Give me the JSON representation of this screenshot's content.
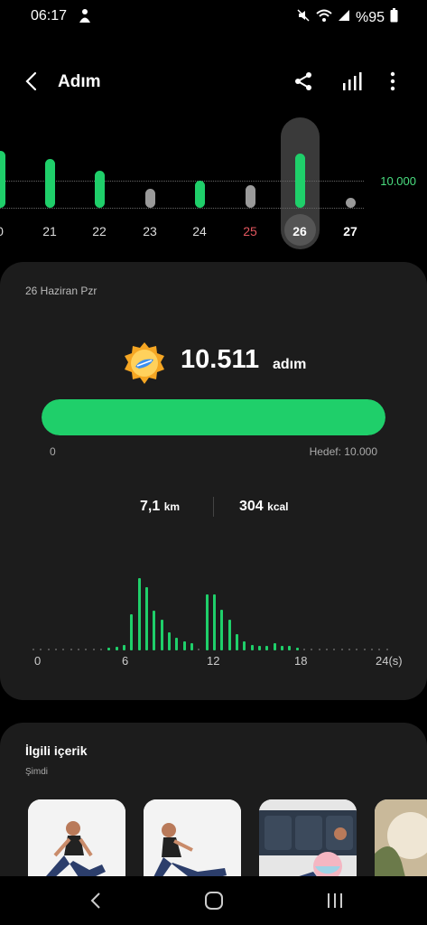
{
  "status": {
    "time": "06:17",
    "battery": "%95"
  },
  "header": {
    "title": "Adım"
  },
  "week": {
    "goal_label": "10.000",
    "days": [
      {
        "label": "0",
        "value": 11000,
        "color": "#1fcf6a",
        "label_color": "#dddddd"
      },
      {
        "label": "21",
        "value": 9500,
        "color": "#1fcf6a",
        "label_color": "#dddddd"
      },
      {
        "label": "22",
        "value": 7200,
        "color": "#1fcf6a",
        "label_color": "#dddddd"
      },
      {
        "label": "23",
        "value": 3600,
        "color": "#9a9a9a",
        "label_color": "#dddddd"
      },
      {
        "label": "24",
        "value": 5200,
        "color": "#1fcf6a",
        "label_color": "#dddddd"
      },
      {
        "label": "25",
        "value": 4400,
        "color": "#9a9a9a",
        "label_color": "#e2565e"
      },
      {
        "label": "26",
        "value": 10511,
        "color": "#1fcf6a",
        "label_color": "#ffffff"
      },
      {
        "label": "27",
        "value": 800,
        "color": "#9a9a9a",
        "label_color": "#ffffff"
      }
    ],
    "selected_index": 6
  },
  "summary": {
    "date": "26 Haziran Pzr",
    "steps": "10.511",
    "unit": "adım",
    "progress": 1.0,
    "min_label": "0",
    "goal_label": "Hedef: 10.000",
    "distance_value": "7,1",
    "distance_unit": "km",
    "calories_value": "304",
    "calories_unit": "kcal"
  },
  "hourly": {
    "x_labels": [
      "0",
      "6",
      "12",
      "18",
      "24(s)"
    ],
    "values": [
      0,
      0,
      0,
      0,
      0,
      0,
      0,
      0,
      0,
      0.02,
      0.04,
      0.05,
      0.08,
      0.5,
      1.0,
      0.88,
      0.55,
      0.42,
      0.25,
      0.18,
      0.12,
      0.1,
      0.03,
      0.78,
      0.77,
      0.56,
      0.42,
      0.22,
      0.12,
      0.08,
      0.06,
      0.06,
      0.1,
      0.06,
      0.06,
      0.04,
      0.02,
      0,
      0,
      0,
      0,
      0,
      0,
      0,
      0,
      0,
      0,
      0
    ]
  },
  "related": {
    "title": "İlgili içerik",
    "subtitle": "Şimdi"
  }
}
